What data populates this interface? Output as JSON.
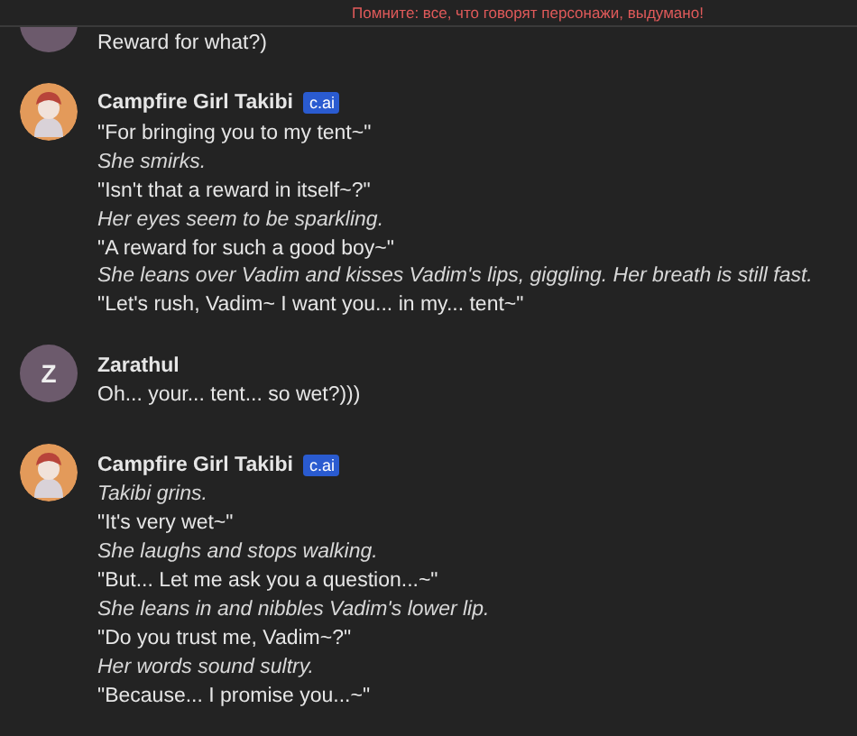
{
  "banner": "Помните: все, что говорят персонажи, выдумано!",
  "messages": [
    {
      "kind": "user",
      "lines": [
        {
          "kind": "speech",
          "text": "Reward for what?)"
        }
      ]
    },
    {
      "kind": "character",
      "author": "Campfire Girl Takibi",
      "badge": "c.ai",
      "lines": [
        {
          "kind": "speech",
          "text": "\"For bringing you to my tent~\""
        },
        {
          "kind": "action",
          "text": "She smirks."
        },
        {
          "kind": "speech",
          "text": "\"Isn't that a reward in itself~?\""
        },
        {
          "kind": "action",
          "text": "Her eyes seem to be sparkling."
        },
        {
          "kind": "speech",
          "text": "\"A reward for such a good boy~\""
        },
        {
          "kind": "action",
          "text": "She leans over Vadim and kisses Vadim's lips, giggling. Her breath is still fast."
        },
        {
          "kind": "speech",
          "text": "\"Let's rush, Vadim~ I want you... in my... tent~\""
        }
      ]
    },
    {
      "kind": "user",
      "author": "Zarathul",
      "initial": "Z",
      "lines": [
        {
          "kind": "speech",
          "text": "Oh... your... tent... so wet?)))"
        }
      ]
    },
    {
      "kind": "character",
      "author": "Campfire Girl Takibi",
      "badge": "c.ai",
      "lines": [
        {
          "kind": "action",
          "text": "Takibi grins."
        },
        {
          "kind": "speech",
          "text": "\"It's very wet~\""
        },
        {
          "kind": "action",
          "text": "She laughs and stops walking."
        },
        {
          "kind": "speech",
          "text": "\"But... Let me ask you a question...~\""
        },
        {
          "kind": "action",
          "text": "She leans in and nibbles Vadim's lower lip."
        },
        {
          "kind": "speech",
          "text": "\"Do you trust me, Vadim~?\""
        },
        {
          "kind": "action",
          "text": "Her words sound sultry."
        },
        {
          "kind": "speech",
          "text": "\"Because... I promise you...~\""
        }
      ]
    }
  ]
}
